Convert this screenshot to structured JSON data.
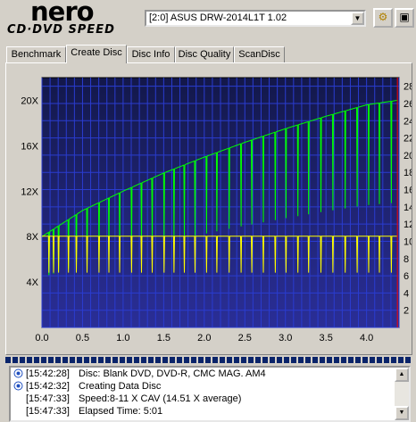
{
  "logo": {
    "brand": "nero",
    "product": "CD·DVD SPEED"
  },
  "drive": {
    "selected": "[2:0]   ASUS DRW-2014L1T 1.02"
  },
  "toolbar": {
    "start_icon": "drive-refresh-icon",
    "save_icon": "save-icon"
  },
  "tabs": [
    {
      "label": "Benchmark",
      "active": false
    },
    {
      "label": "Create Disc",
      "active": true
    },
    {
      "label": "Disc Info",
      "active": false
    },
    {
      "label": "Disc Quality",
      "active": false
    },
    {
      "label": "ScanDisc",
      "active": false
    }
  ],
  "log": [
    {
      "time": "[15:42:28]",
      "message": "Disc: Blank DVD, DVD-R, CMC MAG. AM4",
      "icon": "info-icon"
    },
    {
      "time": "[15:42:32]",
      "message": "Creating Data Disc",
      "icon": "info-icon"
    },
    {
      "time": "[15:47:33]",
      "message": "Speed:8-11 X CAV (14.51 X average)",
      "icon": ""
    },
    {
      "time": "[15:47:33]",
      "message": "Elapsed Time:  5:01",
      "icon": ""
    }
  ],
  "colors": {
    "plot_bg_top": "#13184a",
    "plot_bg_bottom": "#2a2e97",
    "grid": "#2a3cd0",
    "speed_line": "#00ff00",
    "rpm_line": "#ffff00",
    "end_marker": "#ff0000"
  },
  "chart_data": {
    "type": "line",
    "x": [
      0.0,
      0.5,
      1.0,
      1.5,
      2.0,
      2.5,
      3.0,
      3.5,
      4.0,
      4.38
    ],
    "xlim": [
      0,
      4.4
    ],
    "xticks": [
      "0.0",
      "0.5",
      "1.0",
      "1.5",
      "2.0",
      "2.5",
      "3.0",
      "3.5",
      "4.0"
    ],
    "ylim_left": [
      0,
      22
    ],
    "yticks_left": [
      "4X",
      "8X",
      "12X",
      "16X",
      "20X"
    ],
    "ylim_right": [
      0,
      29
    ],
    "yticks_right": [
      "2",
      "4",
      "6",
      "8",
      "10",
      "12",
      "14",
      "16",
      "18",
      "20",
      "22",
      "24",
      "26",
      "28"
    ],
    "series": [
      {
        "values": [
          8.0,
          10.3,
          12.0,
          13.6,
          15.0,
          16.3,
          17.5,
          18.6,
          19.6,
          20.0
        ]
      },
      {
        "values": [
          10.6,
          10.6,
          10.6,
          10.6,
          10.6,
          10.6,
          10.6,
          10.6,
          10.6,
          10.6
        ]
      }
    ],
    "end_marker_x": 4.38,
    "grid": true
  }
}
